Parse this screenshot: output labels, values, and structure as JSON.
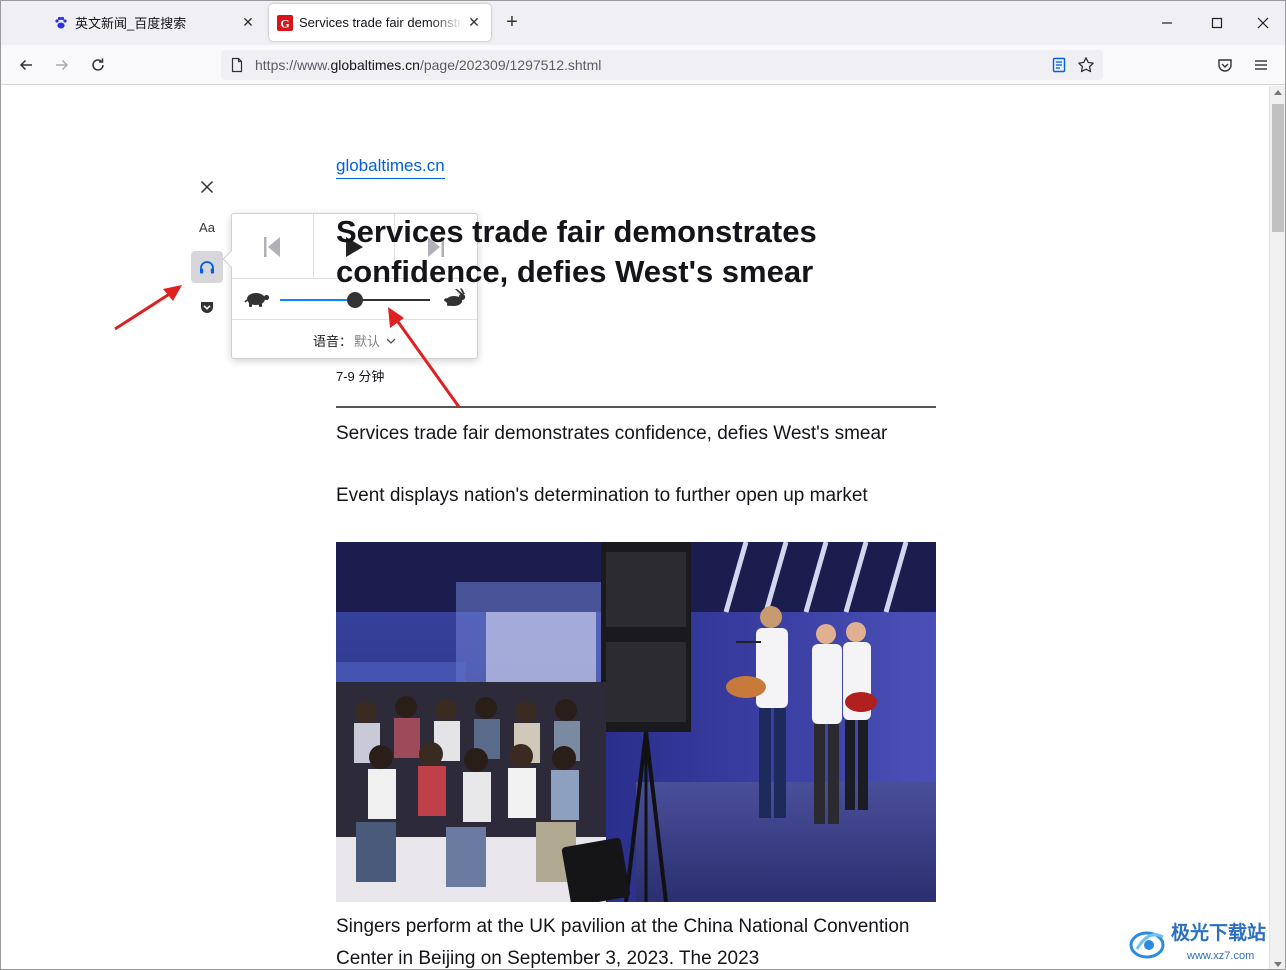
{
  "tabs": [
    {
      "title": "英文新闻_百度搜索",
      "favicon": "baidu-paw-icon",
      "active": false
    },
    {
      "title": "Services trade fair demonstrates confidence, defies West's smear",
      "favicon": "globaltimes-g-icon",
      "active": true
    }
  ],
  "urlbar": {
    "prefix": "https://www.",
    "host": "globaltimes.cn",
    "path": "/page/202309/1297512.shtml"
  },
  "narrate": {
    "voice_label": "语音：",
    "voice_value": "默认",
    "speed_level": 0.5
  },
  "reader_toolbar": {
    "font_label": "Aa"
  },
  "article": {
    "site": "globaltimes.cn",
    "headline": "Services trade fair demonstrates confidence, defies West's smear",
    "reading_time": "7-9 分钟",
    "paragraphs": [
      "Services trade fair demonstrates confidence, defies West's smear",
      "Event displays nation's determination to further open up market"
    ],
    "caption": "Singers perform at the UK pavilion at the China National Convention Center in Beijing on September 3, 2023. The 2023"
  },
  "watermark": {
    "text": "极光下载站",
    "url": "www.xz7.com"
  },
  "colors": {
    "accent": "#0060df",
    "slider_fill": "#0a84ff",
    "annotation_arrow": "#e02020",
    "globaltimes_red": "#d7141a"
  }
}
